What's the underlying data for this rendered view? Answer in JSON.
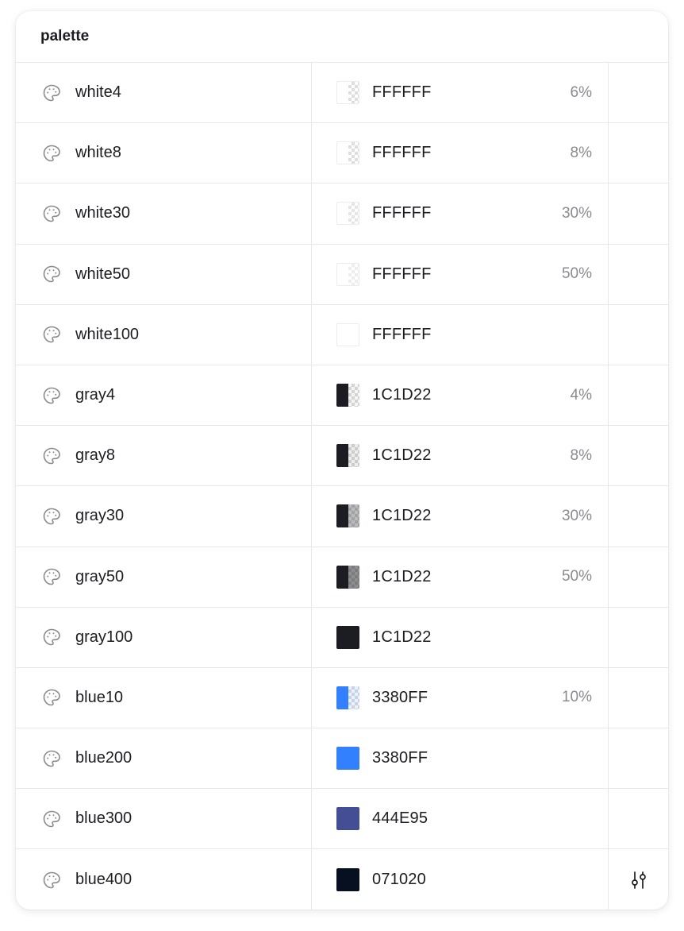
{
  "panel": {
    "title": "palette"
  },
  "rows": [
    {
      "name": "white4",
      "hex": "FFFFFF",
      "opacity": "6%",
      "color": "#FFFFFF",
      "alpha": 0.06
    },
    {
      "name": "white8",
      "hex": "FFFFFF",
      "opacity": "8%",
      "color": "#FFFFFF",
      "alpha": 0.08
    },
    {
      "name": "white30",
      "hex": "FFFFFF",
      "opacity": "30%",
      "color": "#FFFFFF",
      "alpha": 0.3
    },
    {
      "name": "white50",
      "hex": "FFFFFF",
      "opacity": "50%",
      "color": "#FFFFFF",
      "alpha": 0.5
    },
    {
      "name": "white100",
      "hex": "FFFFFF",
      "opacity": "",
      "color": "#FFFFFF",
      "alpha": 1
    },
    {
      "name": "gray4",
      "hex": "1C1D22",
      "opacity": "4%",
      "color": "#1C1D22",
      "alpha": 0.04
    },
    {
      "name": "gray8",
      "hex": "1C1D22",
      "opacity": "8%",
      "color": "#1C1D22",
      "alpha": 0.08
    },
    {
      "name": "gray30",
      "hex": "1C1D22",
      "opacity": "30%",
      "color": "#1C1D22",
      "alpha": 0.3
    },
    {
      "name": "gray50",
      "hex": "1C1D22",
      "opacity": "50%",
      "color": "#1C1D22",
      "alpha": 0.5
    },
    {
      "name": "gray100",
      "hex": "1C1D22",
      "opacity": "",
      "color": "#1C1D22",
      "alpha": 1
    },
    {
      "name": "blue10",
      "hex": "3380FF",
      "opacity": "10%",
      "color": "#3380FF",
      "alpha": 0.1
    },
    {
      "name": "blue200",
      "hex": "3380FF",
      "opacity": "",
      "color": "#3380FF",
      "alpha": 1
    },
    {
      "name": "blue300",
      "hex": "444E95",
      "opacity": "",
      "color": "#444E95",
      "alpha": 1
    },
    {
      "name": "blue400",
      "hex": "071020",
      "opacity": "",
      "color": "#071020",
      "alpha": 1
    }
  ],
  "icons": {
    "row_icon": "palette-icon",
    "action_icon": "sliders-adjust-icon"
  },
  "action_row_index": 13
}
